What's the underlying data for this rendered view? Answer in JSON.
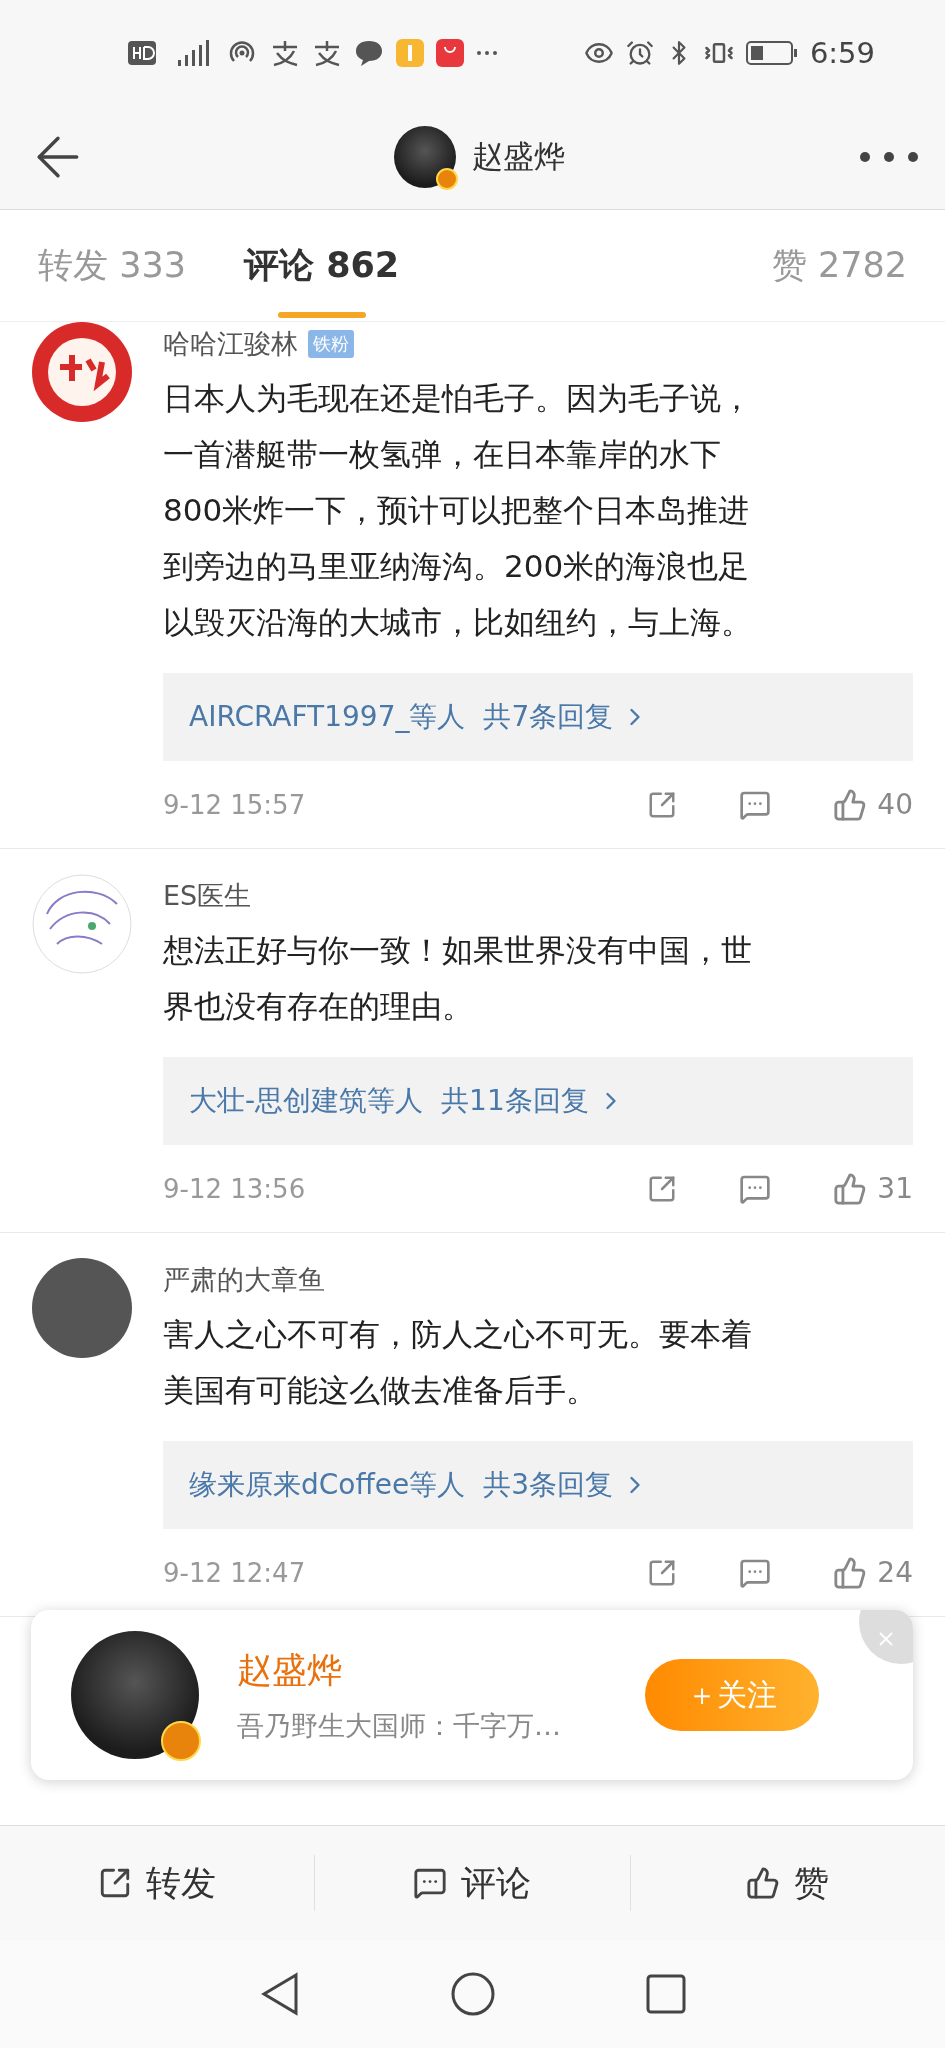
{
  "status_bar": {
    "time": "6:59"
  },
  "header": {
    "title": "赵盛烨",
    "verified": true
  },
  "tabs": [
    {
      "label": "转发",
      "count": "333",
      "selected": false
    },
    {
      "label": "评论",
      "count": "862",
      "selected": true
    },
    {
      "label": "赞",
      "count": "2782",
      "selected": false
    }
  ],
  "comments": [
    {
      "user": "哈哈江骏林",
      "badge": "铁粉",
      "kind": "logo",
      "lines": [
        "日本人为毛现在还是怕毛子。因为毛子说，",
        "一首潜艇带一枚氢弹，在日本靠岸的水下",
        "800米炸一下，预计可以把整个日本岛推进",
        "到旁边的马里亚纳海沟。200米的海浪也足",
        "以毁灭沿海的大城市，比如纽约，与上海。"
      ],
      "reply_users": "AIRCRAFT1997_等人",
      "reply_count": "共7条回复",
      "time": "9-12 15:57",
      "likes": "40"
    },
    {
      "user": "ES医生",
      "kind": "pattern",
      "lines": [
        "想法正好与你一致！如果世界没有中国，世",
        "界也没有存在的理由。"
      ],
      "reply_users": "大壮-思创建筑等人",
      "reply_count": "共11条回复",
      "time": "9-12 13:56",
      "likes": "31"
    },
    {
      "user": "严肃的大章鱼",
      "kind": "photo",
      "lines": [
        "害人之心不可有，防人之心不可无。要本着",
        "美国有可能这么做去准备后手。"
      ],
      "reply_users": "缘来原来dCoffee等人",
      "reply_count": "共3条回复",
      "time": "9-12 12:47",
      "likes": "24"
    }
  ],
  "popup": {
    "name": "赵盛烨",
    "bio": "吾乃野生大国师：千字万…",
    "follow": "＋关注",
    "verified": true
  },
  "bottom_bar": [
    {
      "kind": "share",
      "label": "转发"
    },
    {
      "kind": "comment",
      "label": "评论"
    },
    {
      "kind": "like",
      "label": "赞"
    }
  ]
}
